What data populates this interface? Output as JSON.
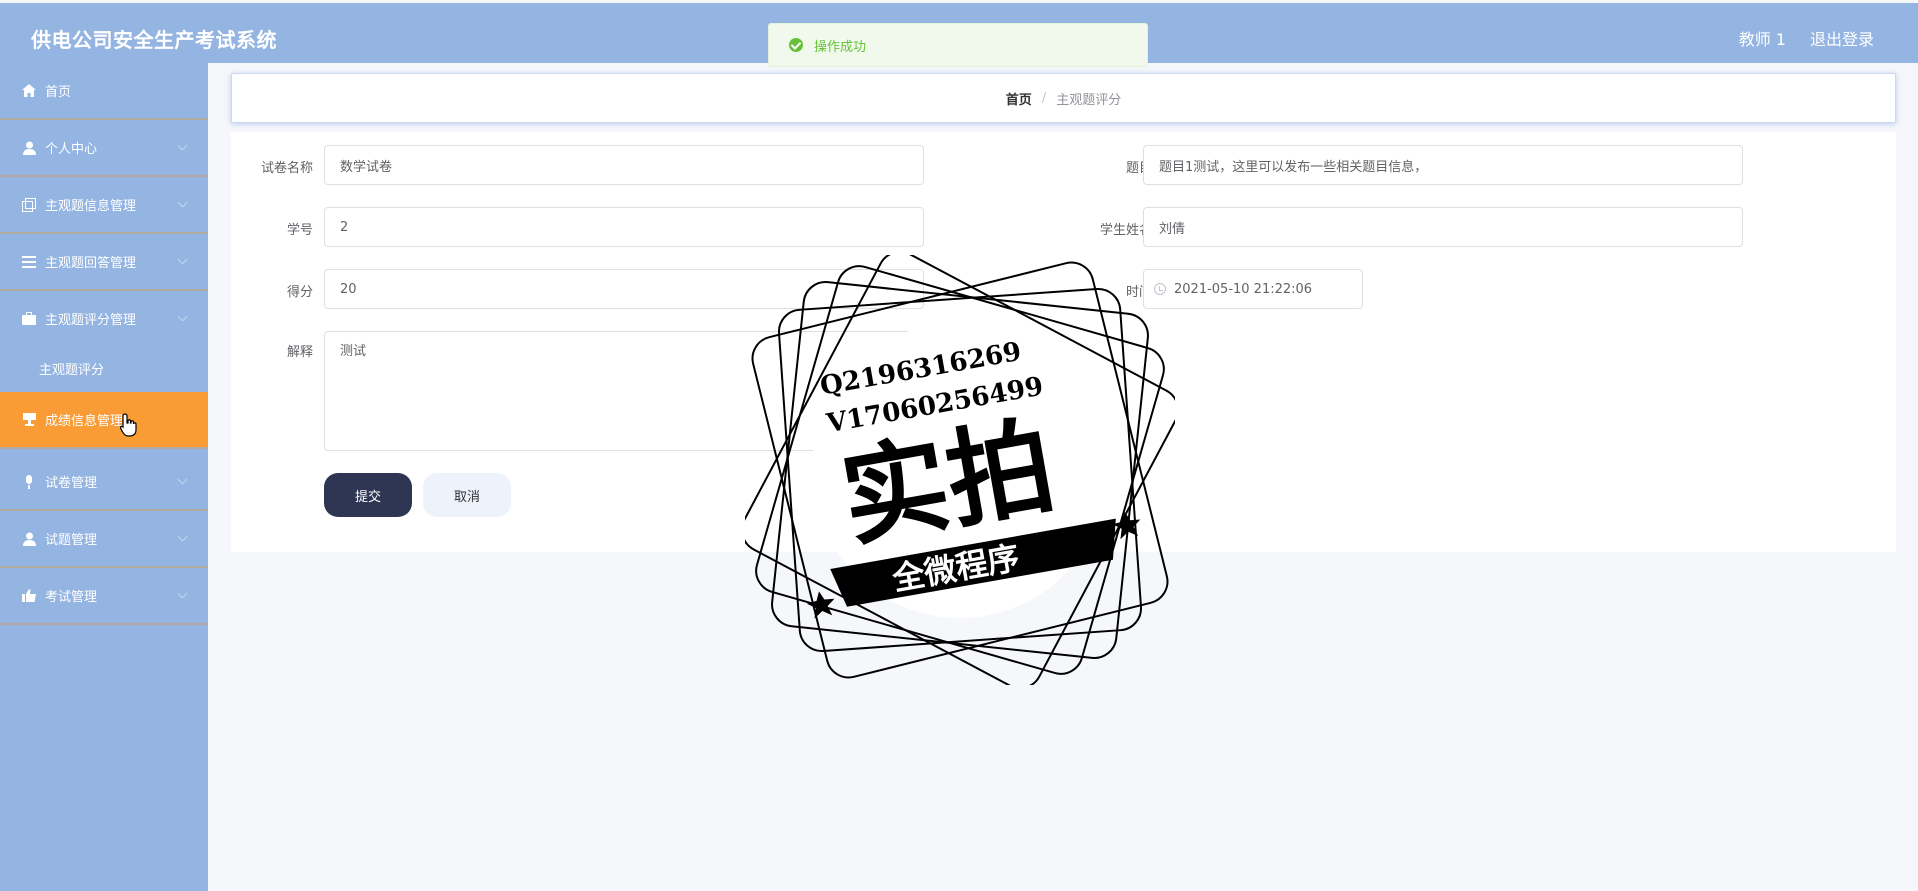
{
  "header": {
    "app_title": "供电公司安全生产考试系统",
    "user": "教师 1",
    "logout": "退出登录"
  },
  "toast": {
    "message": "操作成功"
  },
  "sidebar": {
    "items": [
      {
        "label": "首页",
        "icon": "home-icon"
      },
      {
        "label": "个人中心",
        "icon": "user-icon"
      },
      {
        "label": "主观题信息管理",
        "icon": "copy-icon"
      },
      {
        "label": "主观题回答管理",
        "icon": "list-icon"
      },
      {
        "label": "主观题评分管理",
        "icon": "briefcase-icon"
      },
      {
        "label": "成绩信息管理",
        "icon": "cup-icon"
      },
      {
        "label": "试卷管理",
        "icon": "mic-icon"
      },
      {
        "label": "试题管理",
        "icon": "user-icon"
      },
      {
        "label": "考试管理",
        "icon": "thumb-icon"
      }
    ],
    "sub_items": [
      {
        "label": "主观题评分"
      }
    ]
  },
  "breadcrumb": {
    "home": "首页",
    "separator": "/",
    "current": "主观题评分"
  },
  "form": {
    "paper_name": {
      "label": "试卷名称",
      "value": "数学试卷"
    },
    "question": {
      "label": "题目",
      "value": "题目1测试，这里可以发布一些相关题目信息，"
    },
    "student_id": {
      "label": "学号",
      "value": "2"
    },
    "student_name": {
      "label": "学生姓名",
      "value": "刘倩"
    },
    "score": {
      "label": "得分",
      "value": "20"
    },
    "time": {
      "label": "时间",
      "value": "2021-05-10 21:22:06"
    },
    "explanation": {
      "label": "解释",
      "value": "测试"
    },
    "submit_label": "提交",
    "cancel_label": "取消"
  },
  "stamp": {
    "line1": "Q2196316269",
    "line2": "V17060256499",
    "main": "实拍",
    "banner": "全微程序"
  },
  "colors": {
    "header_bg": "#94b4e2",
    "sidebar_bg": "#94b4e2",
    "active_item": "#f99c36",
    "submit_bg": "#2f3653",
    "success": "#67c23a"
  }
}
